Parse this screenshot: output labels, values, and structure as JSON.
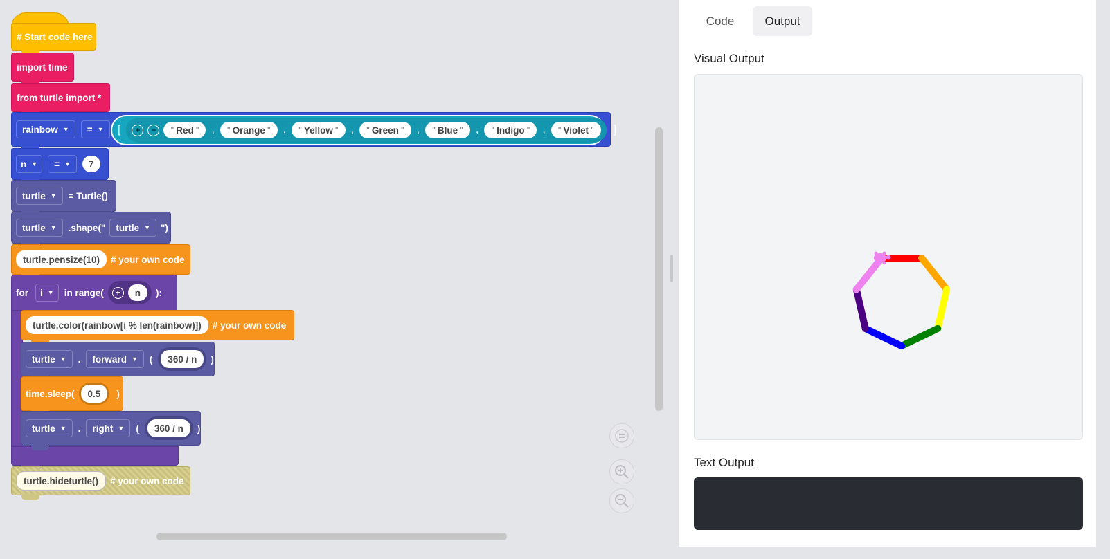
{
  "blocks": {
    "start_comment": "# Start code here",
    "import_time": "import time",
    "from_turtle": "from turtle import *",
    "rainbow_var": "rainbow",
    "eq": "=",
    "list_open": "[",
    "list_close": "]",
    "colors": [
      "Red",
      "Orange",
      "Yellow",
      "Green",
      "Blue",
      "Indigo",
      "Violet"
    ],
    "n_var": "n",
    "n_value": "7",
    "turtle_var": "turtle",
    "turtle_ctor": "= Turtle()",
    "shape_call": ".shape(\"",
    "shape_value": "turtle",
    "shape_close": "\")",
    "pensize_code": "turtle.pensize(10)",
    "own_code_comment": "# your own code",
    "for_kw": "for",
    "i_var": "i",
    "in_range": "in range(",
    "range_arg": "n",
    "range_close": "):",
    "color_code": "turtle.color(rainbow[i % len(rainbow)])",
    "dot": ".",
    "forward_method": "forward",
    "paren_open": "(",
    "paren_close": ")",
    "step_expr": "360 / n",
    "sleep_call": "time.sleep(",
    "sleep_value": "0.5",
    "right_method": "right",
    "hideturtle_code": "turtle.hideturtle()"
  },
  "tabs": {
    "code": "Code",
    "output": "Output",
    "active": "Output"
  },
  "output": {
    "visual_label": "Visual Output",
    "text_label": "Text Output",
    "text_content": ""
  },
  "drawing": {
    "segment_colors": [
      "#ff0000",
      "#ffa500",
      "#ffff00",
      "#008000",
      "#0000ff",
      "#4b0082",
      "#ee82ee"
    ]
  },
  "icons": {
    "zoom_reset": "reset-icon",
    "zoom_in": "zoom-in-icon",
    "zoom_out": "zoom-out-icon"
  }
}
